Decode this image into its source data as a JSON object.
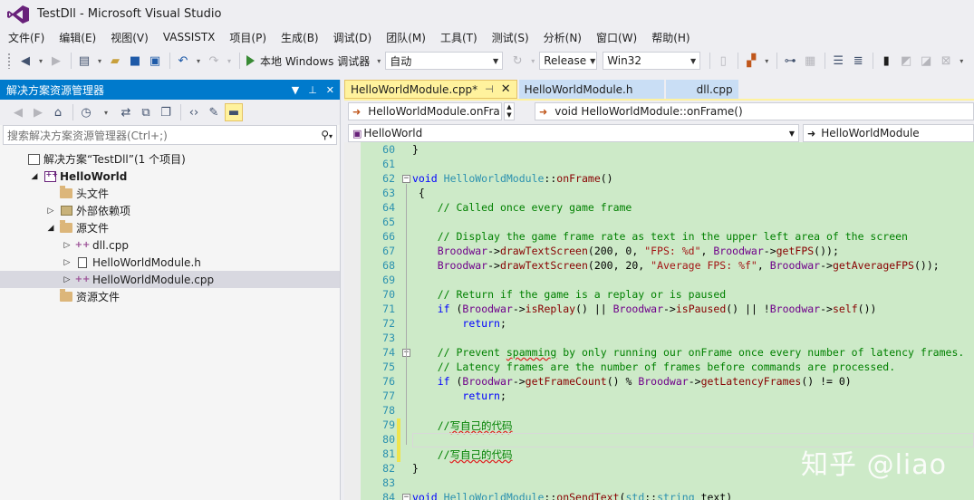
{
  "window": {
    "title": "TestDll - Microsoft Visual Studio"
  },
  "menu": [
    "文件(F)",
    "编辑(E)",
    "视图(V)",
    "VASSISTX",
    "项目(P)",
    "生成(B)",
    "调试(D)",
    "团队(M)",
    "工具(T)",
    "测试(S)",
    "分析(N)",
    "窗口(W)",
    "帮助(H)"
  ],
  "toolbar": {
    "run_label": "本地 Windows 调试器",
    "config_auto": "自动",
    "configuration": "Release",
    "platform": "Win32"
  },
  "solution_explorer": {
    "title": "解决方案资源管理器",
    "search_placeholder": "搜索解决方案资源管理器(Ctrl+;)",
    "items": [
      {
        "label": "解决方案“TestDll”(1 个项目)",
        "icon": "solution-icon",
        "indent": 0,
        "expander": ""
      },
      {
        "label": "HelloWorld",
        "icon": "project-icon",
        "indent": 1,
        "expander": "◢",
        "bold": true
      },
      {
        "label": "头文件",
        "icon": "folder-icon",
        "indent": 2,
        "expander": ""
      },
      {
        "label": "外部依赖项",
        "icon": "references-icon",
        "indent": 2,
        "expander": "▷"
      },
      {
        "label": "源文件",
        "icon": "folder-icon",
        "indent": 2,
        "expander": "◢"
      },
      {
        "label": "dll.cpp",
        "icon": "cpp-file-icon",
        "indent": 3,
        "expander": "▷"
      },
      {
        "label": "HelloWorldModule.h",
        "icon": "header-file-icon",
        "indent": 3,
        "expander": "▷"
      },
      {
        "label": "HelloWorldModule.cpp",
        "icon": "cpp-file-icon",
        "indent": 3,
        "expander": "▷",
        "selected": true
      },
      {
        "label": "资源文件",
        "icon": "folder-icon",
        "indent": 2,
        "expander": ""
      }
    ]
  },
  "tabs": [
    {
      "label": "HelloWorldModule.cpp*",
      "active": true
    },
    {
      "label": "HelloWorldModule.h",
      "active": false
    },
    {
      "label": "dll.cpp",
      "active": false
    }
  ],
  "navigation": {
    "member_left": "HelloWorldModule.onFra",
    "member_right": "void HelloWorldModule::onFrame()",
    "project": "HelloWorld",
    "scope": "HelloWorldModule"
  },
  "code": {
    "lines": [
      {
        "n": "60",
        "html": "}"
      },
      {
        "n": "61",
        "html": ""
      },
      {
        "n": "62",
        "html": "<span class='kw'>void</span> <span class='cls'>HelloWorldModule</span>::<span class='fn'>onFrame</span>()",
        "fold": "⊟"
      },
      {
        "n": "63",
        "html": " {"
      },
      {
        "n": "64",
        "html": "    <span class='cm'>// Called once every game frame</span>"
      },
      {
        "n": "65",
        "html": ""
      },
      {
        "n": "66",
        "html": "    <span class='cm'>// Display the game frame rate as text in the upper left area of the screen</span>"
      },
      {
        "n": "67",
        "html": "    <span class='mac'>Broodwar</span>-&gt;<span class='fn'>drawTextScreen</span>(200, 0, <span class='st'>\"FPS: %d\"</span>, <span class='mac'>Broodwar</span>-&gt;<span class='fn'>getFPS</span>());"
      },
      {
        "n": "68",
        "html": "    <span class='mac'>Broodwar</span>-&gt;<span class='fn'>drawTextScreen</span>(200, 20, <span class='st'>\"Average FPS: %f\"</span>, <span class='mac'>Broodwar</span>-&gt;<span class='fn'>getAverageFPS</span>());"
      },
      {
        "n": "69",
        "html": ""
      },
      {
        "n": "70",
        "html": "    <span class='cm'>// Return if the game is a replay or is paused</span>"
      },
      {
        "n": "71",
        "html": "    <span class='kw'>if</span> (<span class='mac'>Broodwar</span>-&gt;<span class='fn'>isReplay</span>() || <span class='mac'>Broodwar</span>-&gt;<span class='fn'>isPaused</span>() || !<span class='mac'>Broodwar</span>-&gt;<span class='fn'>self</span>())"
      },
      {
        "n": "72",
        "html": "        <span class='kw'>return</span>;"
      },
      {
        "n": "73",
        "html": ""
      },
      {
        "n": "74",
        "html": "    <span class='cm'>// Prevent <span class='sq'>spamming</span> by only running our onFrame once every number of latency frames.</span>",
        "fold": "⊟"
      },
      {
        "n": "75",
        "html": "    <span class='cm'>// Latency frames are the number of frames before commands are processed.</span>"
      },
      {
        "n": "76",
        "html": "    <span class='kw'>if</span> (<span class='mac'>Broodwar</span>-&gt;<span class='fn'>getFrameCount</span>() % <span class='mac'>Broodwar</span>-&gt;<span class='fn'>getLatencyFrames</span>() != 0)"
      },
      {
        "n": "77",
        "html": "        <span class='kw'>return</span>;"
      },
      {
        "n": "78",
        "html": ""
      },
      {
        "n": "79",
        "html": "    <span class='cm'>//<span class='sq'>写自己的代码</span></span>",
        "changed": true
      },
      {
        "n": "80",
        "html": "",
        "changed": true,
        "current": true
      },
      {
        "n": "81",
        "html": "    <span class='cm'>//<span class='sq'>写自己的代码</span></span>",
        "changed": true
      },
      {
        "n": "82",
        "html": "}"
      },
      {
        "n": "83",
        "html": ""
      },
      {
        "n": "84",
        "html": "<span class='kw'>void</span> <span class='cls'>HelloWorldModule</span>::<span class='fn'>onSendText</span>(<span class='cls'>std</span>::<span class='cls'>string</span> text)",
        "fold": "⊟"
      }
    ]
  },
  "watermark": "知乎 @liao"
}
